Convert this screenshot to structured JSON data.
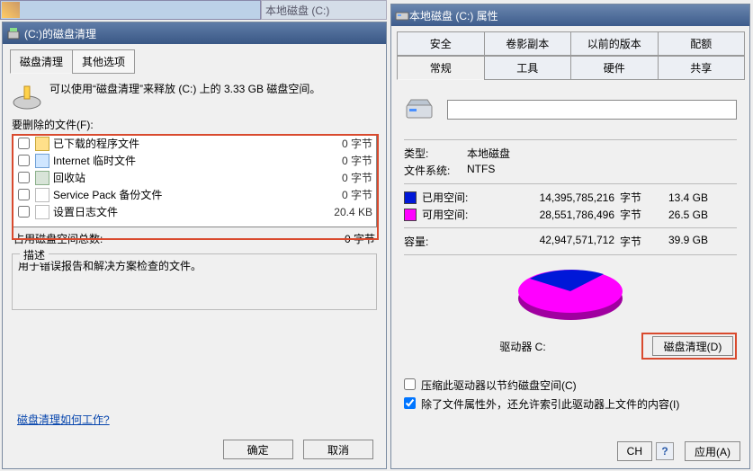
{
  "bg_tab_label": "本地磁盘 (C:)",
  "cleanup": {
    "title": "(C:)的磁盘清理",
    "tabs": {
      "tab1": "磁盘清理",
      "tab2": "其他选项"
    },
    "intro": "可以使用“磁盘清理”来释放 (C:) 上的 3.33 GB 磁盘空间。",
    "delete_label": "要删除的文件(F):",
    "files": [
      {
        "name": "已下载的程序文件",
        "size": "0 字节",
        "icon": "ic-folder"
      },
      {
        "name": "Internet 临时文件",
        "size": "0 字节",
        "icon": "ic-ie"
      },
      {
        "name": "回收站",
        "size": "0 字节",
        "icon": "ic-bin"
      },
      {
        "name": "Service Pack 备份文件",
        "size": "0 字节",
        "icon": "ic-doc"
      },
      {
        "name": "设置日志文件",
        "size": "20.4 KB",
        "icon": "ic-doc"
      }
    ],
    "total_label": "占用磁盘空间总数:",
    "total_value": "0 字节",
    "desc_legend": "描述",
    "desc_text": "用于错误报告和解决方案检查的文件。",
    "help_link": "磁盘清理如何工作?",
    "ok": "确定",
    "cancel": "取消"
  },
  "props": {
    "title": "本地磁盘 (C:) 属性",
    "tabs_row1": {
      "t1": "安全",
      "t2": "卷影副本",
      "t3": "以前的版本",
      "t4": "配额"
    },
    "tabs_row2": {
      "t1": "常规",
      "t2": "工具",
      "t3": "硬件",
      "t4": "共享"
    },
    "name_value": "",
    "type_label": "类型:",
    "type_value": "本地磁盘",
    "fs_label": "文件系统:",
    "fs_value": "NTFS",
    "used_label": "已用空间:",
    "used_bytes": "14,395,785,216",
    "used_unit": "字节",
    "used_gb": "13.4 GB",
    "free_label": "可用空间:",
    "free_bytes": "28,551,786,496",
    "free_unit": "字节",
    "free_gb": "26.5 GB",
    "cap_label": "容量:",
    "cap_bytes": "42,947,571,712",
    "cap_unit": "字节",
    "cap_gb": "39.9 GB",
    "drive_caption": "驱动器 C:",
    "cleanup_btn": "磁盘清理(D)",
    "chk_compress": "压缩此驱动器以节约磁盘空间(C)",
    "chk_index": "除了文件属性外，还允许索引此驱动器上文件的内容(I)",
    "ch_label": "CH",
    "apply": "应用(A)"
  },
  "chart_data": {
    "type": "pie",
    "title": "驱动器 C:",
    "series": [
      {
        "name": "已用空间",
        "value": 14395785216,
        "color": "#0018d8"
      },
      {
        "name": "可用空间",
        "value": 28551786496,
        "color": "#ff00ff"
      }
    ]
  }
}
